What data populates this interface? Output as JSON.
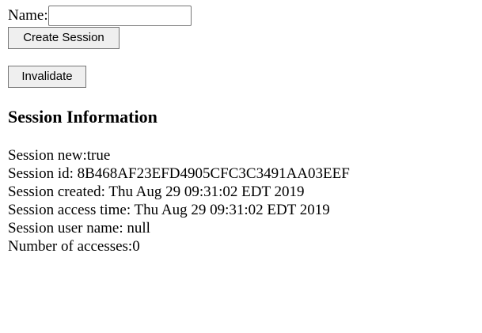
{
  "form": {
    "name_label": "Name:",
    "name_value": "",
    "create_button": "Create Session",
    "invalidate_button": "Invalidate"
  },
  "session_info": {
    "heading": "Session Information",
    "lines": [
      "Session new:true",
      "Session id: 8B468AF23EFD4905CFC3C3491AA03EEF",
      "Session created: Thu Aug 29 09:31:02 EDT 2019",
      "Session access time: Thu Aug 29 09:31:02 EDT 2019",
      "Session user name: null",
      "Number of accesses:0"
    ]
  }
}
